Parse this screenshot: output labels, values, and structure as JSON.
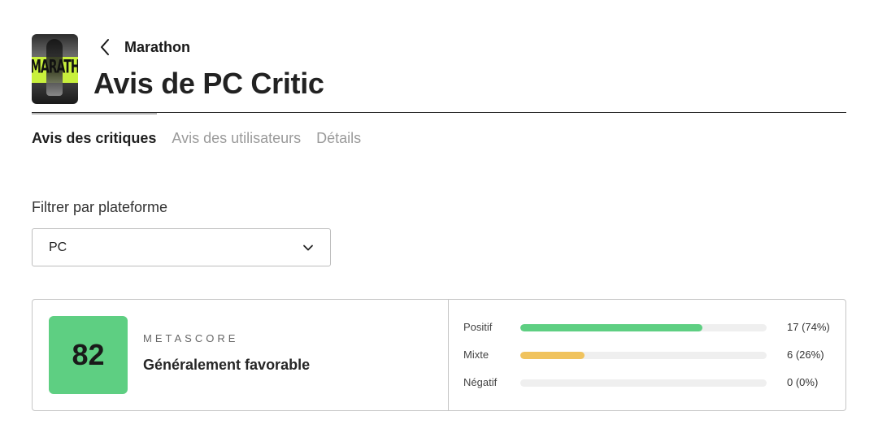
{
  "header": {
    "back_label": "Marathon",
    "title": "Avis de PC Critic",
    "thumbnail_text": "MARATHON"
  },
  "tabs": [
    {
      "label": "Avis des critiques",
      "active": true
    },
    {
      "label": "Avis des utilisateurs",
      "active": false
    },
    {
      "label": "Détails",
      "active": false
    }
  ],
  "filter": {
    "label": "Filtrer par plateforme",
    "selected": "PC"
  },
  "metascore": {
    "score": "82",
    "label": "METASCORE",
    "description": "Généralement favorable",
    "color": "#5ecf82"
  },
  "distribution": [
    {
      "label": "Positif",
      "count": "17 (74%)",
      "fraction": 0.74,
      "color": "#5ecf82"
    },
    {
      "label": "Mixte",
      "count": "6 (26%)",
      "fraction": 0.26,
      "color": "#f0c35e"
    },
    {
      "label": "Négatif",
      "count": "0 (0%)",
      "fraction": 0,
      "color": "#e85d5d"
    }
  ]
}
